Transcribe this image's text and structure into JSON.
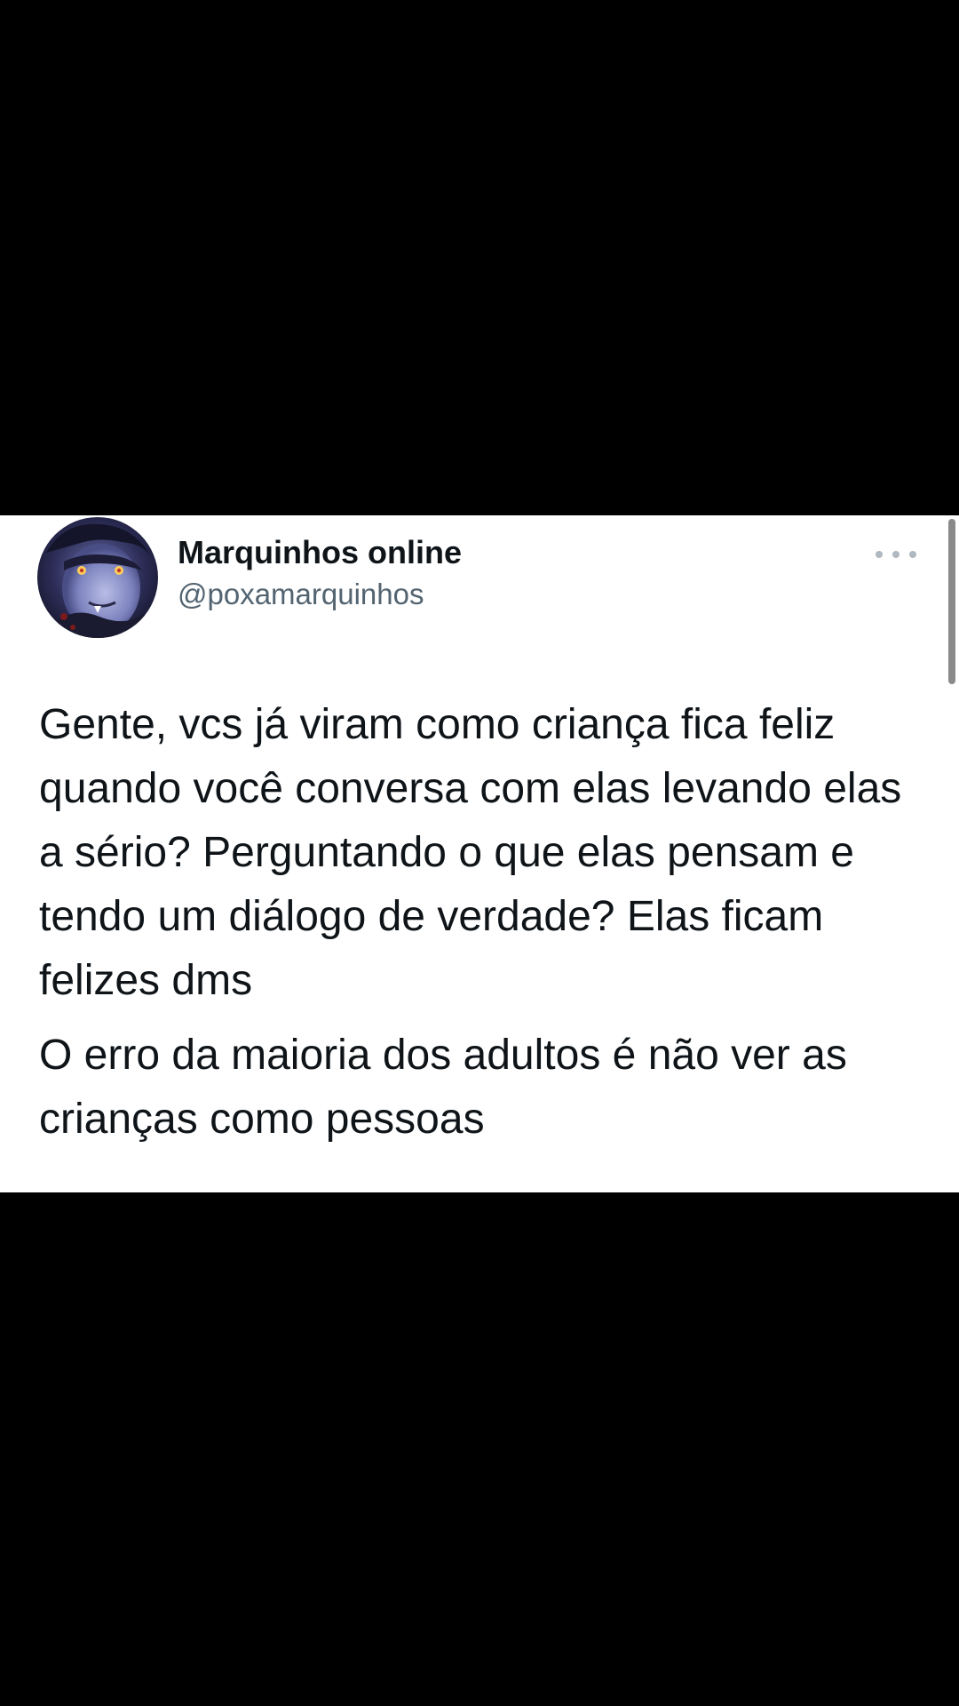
{
  "tweet": {
    "author": {
      "display_name": "Marquinhos online",
      "handle": "@poxamarquinhos",
      "avatar_icon": "avatar-illustration"
    },
    "more_icon": "more-options-icon",
    "paragraphs": [
      "Gente, vcs já viram como criança fica feliz quando você conversa com elas levando elas a sério? Perguntando o que elas pensam e tendo um diálogo de verdade? Elas ficam felizes dms",
      "O erro da maioria dos adultos é não ver as crianças como pessoas"
    ]
  },
  "colors": {
    "background": "#000000",
    "card": "#ffffff",
    "text_primary": "#0f1419",
    "text_secondary": "#536471",
    "scrollbar": "#8a8a8a"
  }
}
